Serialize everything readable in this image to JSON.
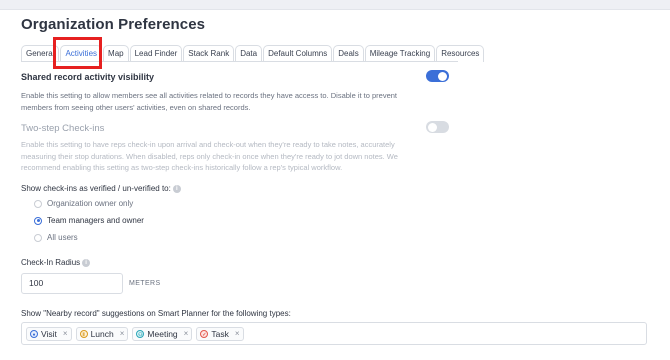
{
  "page": {
    "title": "Organization Preferences"
  },
  "tabs": [
    {
      "label": "General"
    },
    {
      "label": "Activities",
      "active": true
    },
    {
      "label": "Map"
    },
    {
      "label": "Lead Finder"
    },
    {
      "label": "Stack Rank"
    },
    {
      "label": "Data"
    },
    {
      "label": "Default Columns"
    },
    {
      "label": "Deals"
    },
    {
      "label": "Mileage Tracking"
    },
    {
      "label": "Resources"
    }
  ],
  "shared_visibility": {
    "title": "Shared record activity visibility",
    "description": "Enable this setting to allow members see all activities related to records they have access to. Disable it to prevent members from seeing other users' activities, even on shared records.",
    "enabled": true
  },
  "two_step": {
    "title": "Two-step Check-ins",
    "description": "Enable this setting to have reps check-in upon arrival and check-out when they're ready to take notes, accurately measuring their stop durations. When disabled, reps only check-in once when they're ready to jot down notes. We recommend enabling this setting as two-step check-ins historically follow a rep's typical workflow.",
    "enabled": false
  },
  "verified": {
    "label": "Show check-ins as verified / un-verified to:",
    "options": [
      {
        "label": "Organization owner only",
        "checked": false
      },
      {
        "label": "Team managers and owner",
        "checked": true
      },
      {
        "label": "All users",
        "checked": false
      }
    ]
  },
  "radius": {
    "label": "Check-In Radius",
    "value": "100",
    "unit": "METERS"
  },
  "nearby": {
    "label": "Show \"Nearby record\" suggestions on Smart Planner for the following types:",
    "chips": [
      {
        "label": "Visit",
        "icon": "visit-icon",
        "color": "#3b6fd8",
        "bg": "#e6eefc"
      },
      {
        "label": "Lunch",
        "icon": "lunch-icon",
        "color": "#d99a1e",
        "bg": "#fdf1d8"
      },
      {
        "label": "Meeting",
        "icon": "meeting-icon",
        "color": "#2aa6b8",
        "bg": "#dcf3f6"
      },
      {
        "label": "Task",
        "icon": "task-icon",
        "color": "#e2574c",
        "bg": "#fde3e1"
      }
    ]
  },
  "colors": {
    "accent": "#3b6fd8",
    "highlight": "#e62020"
  }
}
